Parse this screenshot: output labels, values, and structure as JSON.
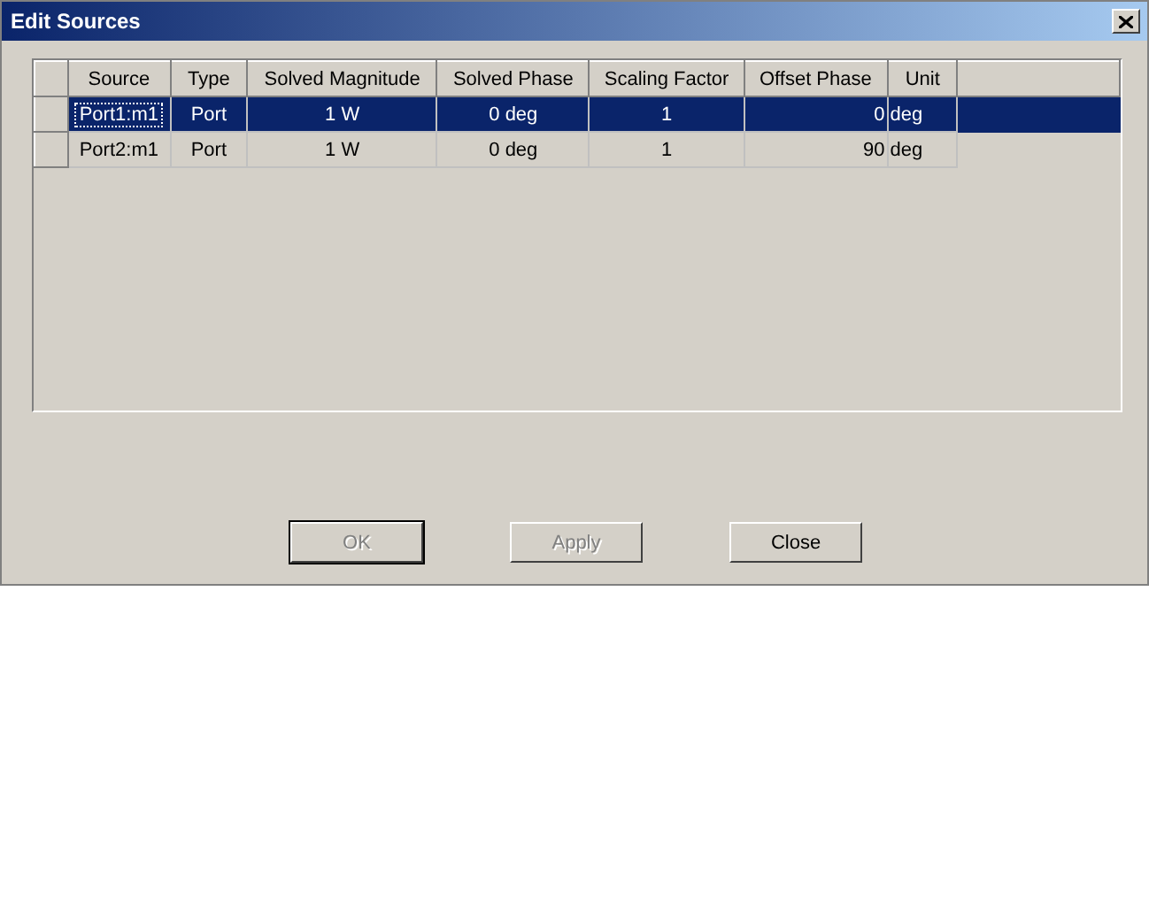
{
  "window": {
    "title": "Edit Sources"
  },
  "table": {
    "columns": [
      "Source",
      "Type",
      "Solved Magnitude",
      "Solved Phase",
      "Scaling Factor",
      "Offset Phase",
      "Unit"
    ],
    "rows": [
      {
        "selected": true,
        "cells": [
          "Port1:m1",
          "Port",
          "1 W",
          "0 deg",
          "1",
          "0",
          "deg"
        ]
      },
      {
        "selected": false,
        "cells": [
          "Port2:m1",
          "Port",
          "1 W",
          "0 deg",
          "1",
          "90",
          "deg"
        ]
      }
    ]
  },
  "buttons": [
    {
      "label": "OK",
      "disabled": true
    },
    {
      "label": "Apply",
      "disabled": true
    },
    {
      "label": "Close",
      "disabled": false
    }
  ]
}
